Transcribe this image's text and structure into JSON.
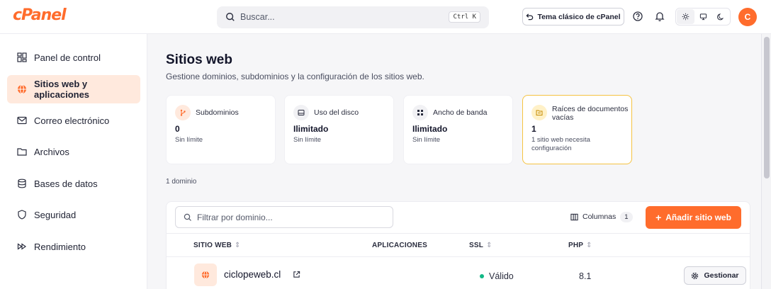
{
  "header": {
    "logo_text": "cPanel",
    "search_placeholder": "Buscar...",
    "search_shortcut": "Ctrl K",
    "classic_theme_label": "Tema clásico de cPanel",
    "avatar_initial": "C",
    "brand_color": "#ff6c2c"
  },
  "sidebar": {
    "items": [
      {
        "label": "Panel de control",
        "icon": "dashboard-icon",
        "active": false
      },
      {
        "label": "Sitios web y aplicaciones",
        "icon": "globe-icon",
        "active": true
      },
      {
        "label": "Correo electrónico",
        "icon": "mail-icon",
        "active": false
      },
      {
        "label": "Archivos",
        "icon": "folder-icon",
        "active": false
      },
      {
        "label": "Bases de datos",
        "icon": "database-icon",
        "active": false
      },
      {
        "label": "Seguridad",
        "icon": "shield-icon",
        "active": false
      },
      {
        "label": "Rendimiento",
        "icon": "fast-forward-icon",
        "active": false
      }
    ]
  },
  "main": {
    "title": "Sitios web",
    "subtitle": "Gestione dominios, subdominios y la configuración de los sitios web.",
    "stats": [
      {
        "title": "Subdominios",
        "value": "0",
        "note": "Sin límite",
        "icon": "branch-icon"
      },
      {
        "title": "Uso del disco",
        "value": "Ilimitado",
        "note": "Sin límite",
        "icon": "disk-icon"
      },
      {
        "title": "Ancho de banda",
        "value": "Ilimitado",
        "note": "Sin límite",
        "icon": "bandwidth-icon"
      },
      {
        "title": "Raíces de documentos vacías",
        "value": "1",
        "note": "1 sitio web necesita configuración",
        "icon": "folder-warning-icon"
      }
    ],
    "domain_count": "1 dominio",
    "filter_placeholder": "Filtrar por dominio...",
    "columns_label": "Columnas",
    "columns_count": "1",
    "add_site_label": "Añadir sitio web",
    "table": {
      "headers": {
        "site": "SITIO WEB",
        "apps": "APLICACIONES",
        "ssl": "SSL",
        "php": "PHP"
      },
      "rows": [
        {
          "domain": "ciclopeweb.cl",
          "ssl": "Válido",
          "php": "8.1",
          "manage_label": "Gestionar"
        }
      ]
    }
  }
}
